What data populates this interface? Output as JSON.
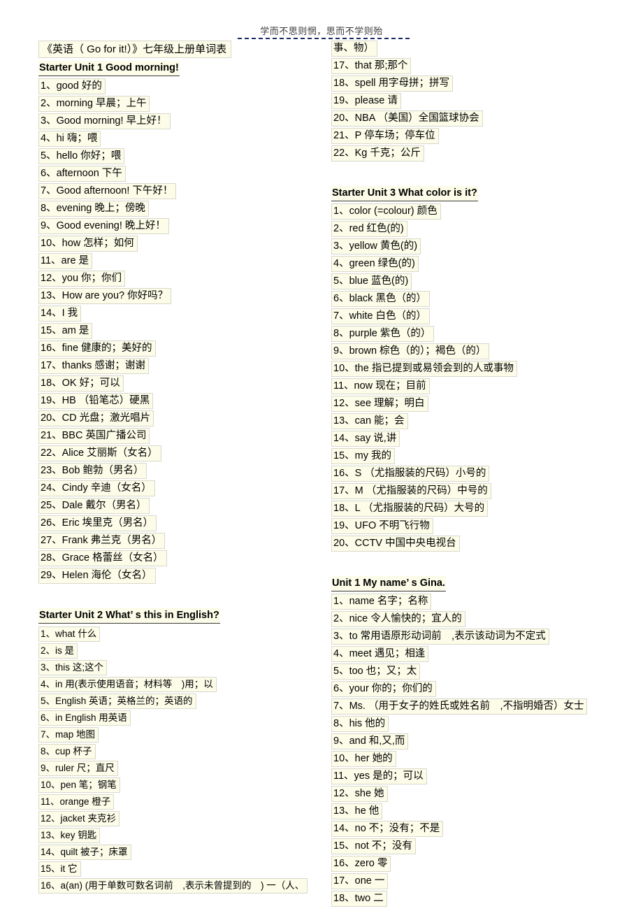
{
  "page": {
    "header_text": "学而不思则惘，思而不学则殆",
    "background_color": "#ffffff",
    "highlight_color": "#fcfce8",
    "rule_color": "#1b2a6b"
  },
  "left_column": {
    "title": "《英语（ Go for it!）》七年级上册单词表",
    "sections": [
      {
        "heading": "Starter Unit 1 Good morning!",
        "items": [
          "1、good  好的",
          "2、morning  早晨；上午",
          "3、Good morning!  早上好！",
          "4、hi  嗨；喂",
          "5、hello  你好；喂",
          "6、afternoon  下午",
          "7、Good afternoon!  下午好！",
          "8、evening  晚上；傍晚",
          "9、Good evening!  晚上好！",
          "10、how  怎样；如何",
          "11、are  是",
          "12、you  你；你们",
          "13、How are you?  你好吗？",
          "14、I  我",
          "15、am  是",
          "16、fine  健康的；美好的",
          "17、thanks  感谢；谢谢",
          "18、OK  好；可以",
          "19、HB  （铅笔芯）硬黑",
          "20、CD  光盘；激光唱片",
          "21、BBC 英国广播公司",
          "22、Alice  艾丽斯（女名）",
          "23、Bob  鲍勃（男名）",
          "24、Cindy  辛迪（女名）",
          "25、Dale  戴尔（男名）",
          "26、Eric  埃里克（男名）",
          "27、Frank  弗兰克（男名）",
          "28、Grace  格蕾丝（女名）",
          "29、Helen  海伦（女名）"
        ]
      },
      {
        "heading": "Starter Unit 2 What’ s this in English?",
        "items": [
          "1、what  什么",
          "2、is 是",
          "3、this  这;这个",
          "4、in  用(表示使用语音；材料等　)用；以",
          "5、English  英语；英格兰的；英语的",
          "6、in English  用英语",
          "7、map  地图",
          "8、cup  杯子",
          "9、ruler  尺；直尺",
          "10、pen  笔；钢笔",
          "11、orange  橙子",
          "12、jacket  夹克衫",
          "13、key  钥匙",
          "14、quilt  被子；床罩",
          "15、it  它",
          "16、a(an) (用于单数可数名词前　,表示未曾提到的　) 一（人、"
        ]
      }
    ]
  },
  "right_column": {
    "continuation": "事、物）",
    "sections": [
      {
        "heading": "",
        "items": [
          "17、that  那;那个",
          "18、spell  用字母拼；拼写",
          "19、please  请",
          "20、NBA （美国）全国篮球协会",
          "21、P  停车场；停车位",
          "22、Kg 千克；公斤"
        ]
      },
      {
        "heading": "Starter Unit 3 What color is it?",
        "items": [
          "1、color (=colour)  颜色",
          "2、red  红色(的)",
          "3、yellow  黄色(的)",
          "4、green  绿色(的)",
          "5、blue  蓝色(的)",
          "6、black  黑色（的）",
          "7、white  白色（的）",
          "8、purple  紫色（的）",
          "9、brown  棕色（的）；褐色（的）",
          "10、the  指已提到或易领会到的人或事物",
          "11、now  现在；目前",
          "12、see  理解；明白",
          "13、can  能；会",
          "14、say  说,讲",
          "15、my  我的",
          "16、S  （尤指服装的尺码）小号的",
          "17、M  （尤指服装的尺码）中号的",
          "18、L  （尤指服装的尺码）大号的",
          "19、UFO  不明飞行物",
          "20、CCTV 中国中央电视台"
        ]
      },
      {
        "heading": "Unit 1 My name’ s Gina.",
        "items": [
          "1、name  名字；名称",
          "2、nice  令人愉快的；宜人的",
          "3、to  常用语原形动词前　,表示该动词为不定式",
          "4、meet  遇见；相逢",
          "5、too  也；又；太",
          "6、your  你的；你们的",
          "7、Ms.  （用于女子的姓氏或姓名前　,不指明婚否）女士",
          "8、his 他的",
          "9、and  和,又,而",
          "10、her  她的",
          "11、yes  是的；可以",
          "12、she  她",
          "13、he  他",
          "14、no  不；没有；不是",
          "15、not  不；没有",
          "16、zero  零",
          "17、one  一",
          "18、two  二"
        ]
      }
    ]
  }
}
